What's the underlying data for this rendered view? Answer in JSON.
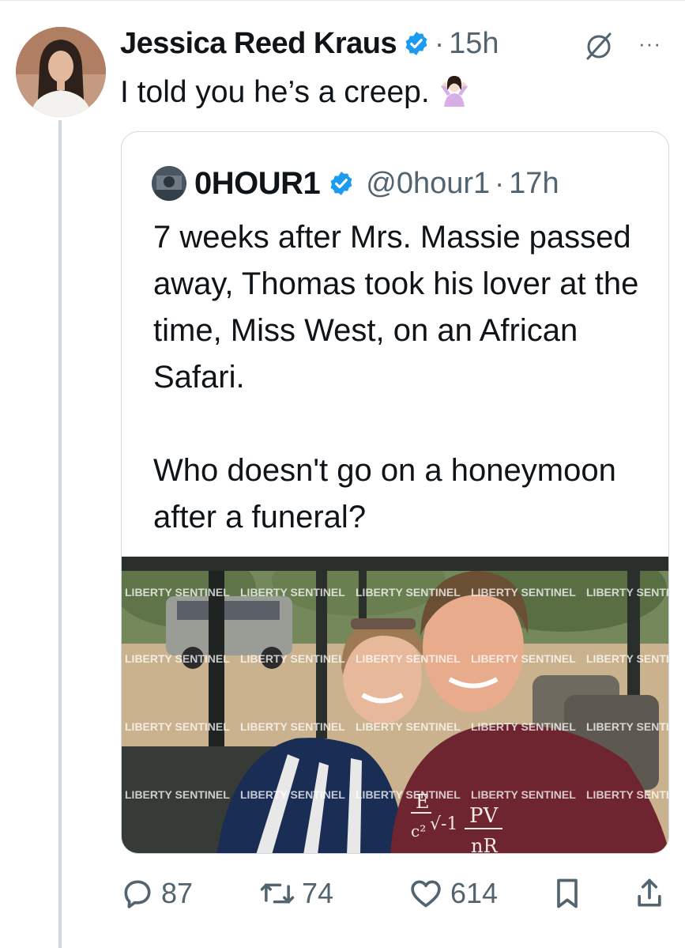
{
  "tweet": {
    "author_name": "Jessica Reed Kraus",
    "separator": "·",
    "time": "15h",
    "more": "···",
    "text": "I told you he’s a creep."
  },
  "quote": {
    "name": "0HOUR1",
    "handle": "@0hour1",
    "separator": "·",
    "time": "17h",
    "paragraphs": [
      "7 weeks after Mrs. Massie passed away, Thomas took his lover at the time, Miss West, on an African Safari.",
      "Who doesn't go on a honeymoon after a funeral?"
    ],
    "watermark": "LIBERTY SENTINEL",
    "shirt_text": {
      "formula_e": "E",
      "formula_c2": "c²",
      "formula_root": "√-1",
      "formula_pv": "PV",
      "formula_nr": "nR"
    }
  },
  "actions": {
    "replies": "87",
    "reposts": "74",
    "likes": "614"
  },
  "colors": {
    "text": "#0f1419",
    "muted": "#536471",
    "verified": "#1d9bf0",
    "border": "#cfd9de"
  },
  "icons": [
    "verified-badge-icon",
    "grok-icon",
    "more-icon",
    "shrug-emoji-icon",
    "reply-icon",
    "repost-icon",
    "like-icon",
    "bookmark-icon",
    "share-icon"
  ]
}
